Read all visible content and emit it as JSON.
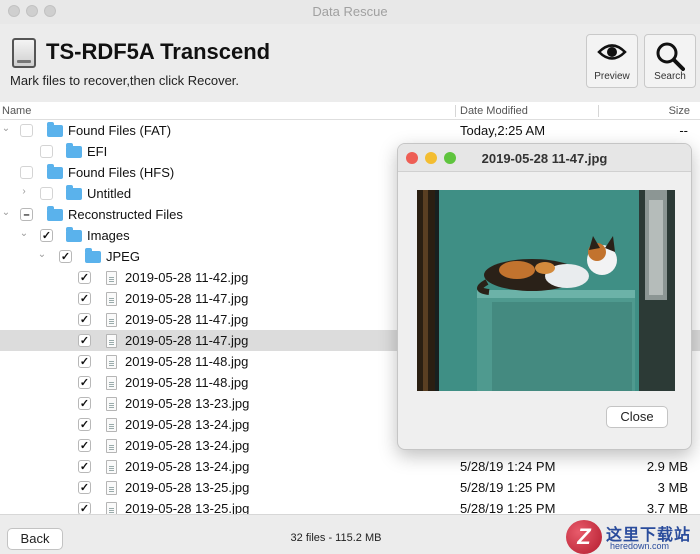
{
  "window": {
    "title": "Data Rescue"
  },
  "header": {
    "device_name": "TS-RDF5A Transcend",
    "instructions": "Mark files to recover,then click Recover.",
    "preview_label": "Preview",
    "search_label": "Search"
  },
  "columns": {
    "name": "Name",
    "date": "Date Modified",
    "size": "Size"
  },
  "rows": [
    {
      "name": "Found Files (FAT)",
      "date": "Today,2:25 AM",
      "size": "--"
    },
    {
      "name": "EFI",
      "date": "",
      "size": ""
    },
    {
      "name": "Found Files (HFS)",
      "date": "",
      "size": ""
    },
    {
      "name": "Untitled",
      "date": "",
      "size": ""
    },
    {
      "name": "Reconstructed Files",
      "date": "",
      "size": ""
    },
    {
      "name": "Images",
      "date": "",
      "size": ""
    },
    {
      "name": "JPEG",
      "date": "",
      "size": ""
    },
    {
      "name": "2019-05-28 11-42.jpg",
      "date": "",
      "size": ""
    },
    {
      "name": "2019-05-28 11-47.jpg",
      "date": "",
      "size": ""
    },
    {
      "name": "2019-05-28 11-47.jpg",
      "date": "",
      "size": ""
    },
    {
      "name": "2019-05-28 11-47.jpg",
      "date": "",
      "size": ""
    },
    {
      "name": "2019-05-28 11-48.jpg",
      "date": "",
      "size": ""
    },
    {
      "name": "2019-05-28 11-48.jpg",
      "date": "",
      "size": ""
    },
    {
      "name": "2019-05-28 13-23.jpg",
      "date": "",
      "size": ""
    },
    {
      "name": "2019-05-28 13-24.jpg",
      "date": "",
      "size": ""
    },
    {
      "name": "2019-05-28 13-24.jpg",
      "date": "",
      "size": ""
    },
    {
      "name": "2019-05-28 13-24.jpg",
      "date": "5/28/19 1:24 PM",
      "size": "2.9 MB"
    },
    {
      "name": "2019-05-28 13-25.jpg",
      "date": "5/28/19 1:25 PM",
      "size": "3 MB"
    },
    {
      "name": "2019-05-28 13-25.jpg",
      "date": "5/28/19 1:25 PM",
      "size": "3.7 MB"
    }
  ],
  "preview": {
    "title": "2019-05-28 11-47.jpg",
    "close_label": "Close"
  },
  "footer": {
    "back_label": "Back",
    "file_count": "32 files - 115.2 MB"
  },
  "watermark": {
    "logo_letter": "Z",
    "cn": "这里下载站",
    "en": "heredown.com"
  },
  "colors": {
    "folder": "#5ab2ec",
    "selected_row": "#dcdcdc",
    "traffic_red": "#ee5e55",
    "traffic_yellow": "#f3bd31",
    "traffic_green": "#5fc43e"
  }
}
